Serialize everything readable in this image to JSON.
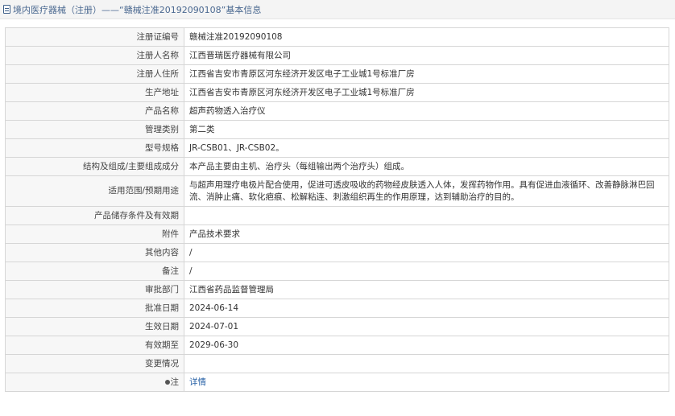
{
  "header": {
    "icon": "document-icon",
    "title": "境内医疗器械（注册）——“赣械注准20192090108”基本信息"
  },
  "rows": [
    {
      "label": "注册证编号",
      "value": "赣械注准20192090108"
    },
    {
      "label": "注册人名称",
      "value": "江西晋瑞医疗器械有限公司"
    },
    {
      "label": "注册人住所",
      "value": "江西省吉安市青原区河东经济开发区电子工业城1号标准厂房"
    },
    {
      "label": "生产地址",
      "value": "江西省吉安市青原区河东经济开发区电子工业城1号标准厂房"
    },
    {
      "label": "产品名称",
      "value": "超声药物透入治疗仪"
    },
    {
      "label": "管理类别",
      "value": "第二类"
    },
    {
      "label": "型号规格",
      "value": "JR-CSB01、JR-CSB02。"
    },
    {
      "label": "结构及组成/主要组成成分",
      "value": "本产品主要由主机、治疗头（每组输出两个治疗头）组成。"
    },
    {
      "label": "适用范围/预期用途",
      "value": "与超声用理疗电极片配合使用，促进可透皮吸收的药物经皮肤透入人体，发挥药物作用。具有促进血液循环、改善静脉淋巴回流、消肿止痛、软化疤痕、松解粘连、刺激组织再生的作用原理，达到辅助治疗的目的。"
    },
    {
      "label": "产品储存条件及有效期",
      "value": ""
    },
    {
      "label": "附件",
      "value": "产品技术要求"
    },
    {
      "label": "其他内容",
      "value": "/"
    },
    {
      "label": "备注",
      "value": "/"
    },
    {
      "label": "审批部门",
      "value": "江西省药品监督管理局"
    },
    {
      "label": "批准日期",
      "value": "2024-06-14"
    },
    {
      "label": "生效日期",
      "value": "2024-07-01"
    },
    {
      "label": "有效期至",
      "value": "2029-06-30"
    },
    {
      "label": "变更情况",
      "value": ""
    }
  ],
  "note_row": {
    "label": "注",
    "label_icon": "bullet-icon",
    "link": "详情"
  }
}
